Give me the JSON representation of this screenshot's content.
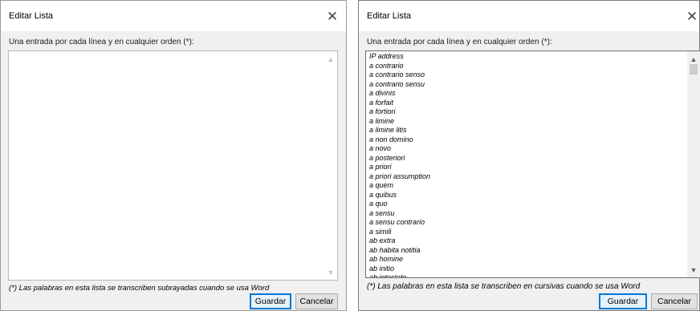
{
  "left_dialog": {
    "title": "Editar Lista",
    "instructions": "Una entrada por cada línea y en cualquier orden (*):",
    "footnote": "(*) Las palabras en esta lista se transcriben subrayadas cuando se usa Word",
    "save_label": "Guardar",
    "cancel_label": "Cancelar",
    "close_glyph": "✕",
    "items": []
  },
  "right_dialog": {
    "title": "Editar Lista",
    "instructions": "Una entrada por cada línea y en cualquier orden (*):",
    "footnote": "(*) Las palabras en esta lista se transcriben en cursivas cuando se usa Word",
    "save_label": "Guardar",
    "cancel_label": "Cancelar",
    "close_glyph": "✕",
    "items": [
      "IP address",
      "a contrario",
      "a contrario senso",
      "a contrario sensu",
      "a divinis",
      "a forfait",
      "a fortiori",
      "a limine",
      "a limine litis",
      "a non domino",
      "a novo",
      "a posteriori",
      "a priori",
      "a priori assumption",
      "a quem",
      "a quibus",
      "a quo",
      "a sensu",
      "a sensu contrario",
      "a simili",
      "ab extra",
      "ab habita notitia",
      "ab homine",
      "ab initio",
      "ab intestato"
    ]
  },
  "icons": {
    "scroll_up": "▲",
    "scroll_down": "▼"
  },
  "colors": {
    "dialog_bg": "#f0f0f0",
    "default_button_border": "#0078d7"
  }
}
